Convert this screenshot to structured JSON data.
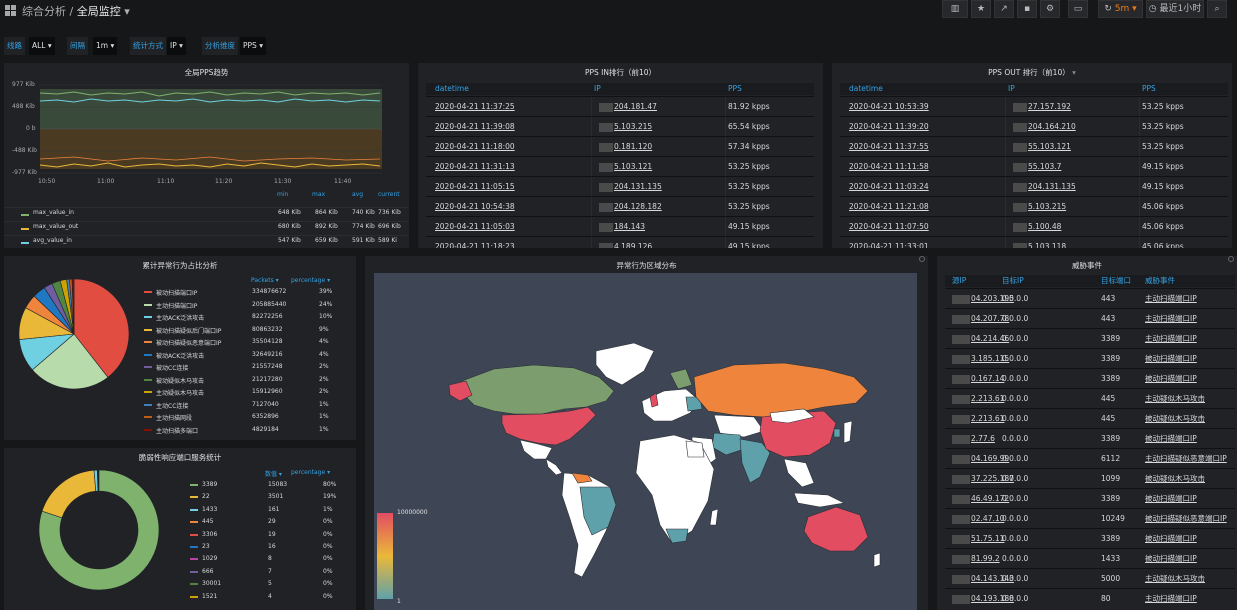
{
  "header": {
    "breadcrumb_parent": "综合分析 / ",
    "breadcrumb_current": "全局监控"
  },
  "toolbar": {
    "refresh_interval": "5m",
    "time_range": "最近1小时"
  },
  "variables": [
    {
      "label": "线路",
      "value": "ALL"
    },
    {
      "label": "间隔",
      "value": "1m"
    },
    {
      "label": "统计方式",
      "value": "IP"
    },
    {
      "label": "分析维度",
      "value": "PPS"
    }
  ],
  "pps_trend": {
    "title": "全局PPS趋势",
    "y_ticks": [
      "977 Kib",
      "488 Kib",
      "0 b",
      "-488 Kib",
      "-977 Kib"
    ],
    "x_ticks": [
      "10:50",
      "11:00",
      "11:10",
      "11:20",
      "11:30",
      "11:40"
    ],
    "legend_headers": [
      "min",
      "max",
      "avg",
      "current"
    ],
    "legend": [
      {
        "name": "max_value_in",
        "color": "#7eb26d",
        "min": "648 Kib",
        "max": "864 Kib",
        "avg": "740 Kib",
        "current": "736 Kib"
      },
      {
        "name": "max_value_out",
        "color": "#eab839",
        "min": "680 Kib",
        "max": "892 Kib",
        "avg": "774 Kib",
        "current": "696 Kib"
      },
      {
        "name": "avg_value_in",
        "color": "#6ed0e0",
        "min": "547 Kib",
        "max": "659 Kib",
        "avg": "591 Kib",
        "current": "589 Ki"
      }
    ]
  },
  "pps_in": {
    "title": "PPS IN排行（前10）",
    "headers": [
      "datetime",
      "IP",
      "PPS"
    ],
    "rows": [
      {
        "datetime": "2020-04-21 11:37:25",
        "ip": "204.181.47",
        "pps": "81.92 kpps"
      },
      {
        "datetime": "2020-04-21 11:39:08",
        "ip": "5.103.215",
        "pps": "65.54 kpps"
      },
      {
        "datetime": "2020-04-21 11:18:00",
        "ip": "0.181.120",
        "pps": "57.34 kpps"
      },
      {
        "datetime": "2020-04-21 11:31:13",
        "ip": "5.103.121",
        "pps": "53.25 kpps"
      },
      {
        "datetime": "2020-04-21 11:05:15",
        "ip": "204.131.135",
        "pps": "53.25 kpps"
      },
      {
        "datetime": "2020-04-21 10:54:38",
        "ip": "204.128.182",
        "pps": "53.25 kpps"
      },
      {
        "datetime": "2020-04-21 11:05:03",
        "ip": "184.143",
        "pps": "49.15 kpps"
      },
      {
        "datetime": "2020-04-21 11:18:23",
        "ip": "4.189.126",
        "pps": "49.15 kpps"
      }
    ]
  },
  "pps_out": {
    "title": "PPS OUT 排行（前10）",
    "headers": [
      "datetime",
      "IP",
      "PPS"
    ],
    "rows": [
      {
        "datetime": "2020-04-21 10:53:39",
        "ip": "27.157.192",
        "pps": "53.25 kpps"
      },
      {
        "datetime": "2020-04-21 11:39:20",
        "ip": "204.164.210",
        "pps": "53.25 kpps"
      },
      {
        "datetime": "2020-04-21 11:37:55",
        "ip": "55.103.121",
        "pps": "53.25 kpps"
      },
      {
        "datetime": "2020-04-21 11:11:58",
        "ip": "55.103.7",
        "pps": "49.15 kpps"
      },
      {
        "datetime": "2020-04-21 11:03:24",
        "ip": "204.131.135",
        "pps": "49.15 kpps"
      },
      {
        "datetime": "2020-04-21 11:21:08",
        "ip": "5.103.215",
        "pps": "45.06 kpps"
      },
      {
        "datetime": "2020-04-21 11:07:50",
        "ip": "5.100.48",
        "pps": "45.06 kpps"
      },
      {
        "datetime": "2020-04-21 11:33:01",
        "ip": "5.103.118",
        "pps": "45.06 kpps"
      }
    ]
  },
  "anomaly_pie": {
    "title": "累计异常行为占比分析",
    "headers": [
      "Packets",
      "percentage"
    ],
    "items": [
      {
        "name": "被动扫描端口IP",
        "packets": "334876672",
        "pct": "39%",
        "color": "#e24d42"
      },
      {
        "name": "主动扫描端口IP",
        "packets": "205885440",
        "pct": "24%",
        "color": "#b7dbab"
      },
      {
        "name": "主动ACK泛洪攻击",
        "packets": "82272256",
        "pct": "10%",
        "color": "#6ed0e0"
      },
      {
        "name": "被动扫描疑似后门端口IP",
        "packets": "80863232",
        "pct": "9%",
        "color": "#eab839"
      },
      {
        "name": "被动扫描疑似恶意端口IP",
        "packets": "35504128",
        "pct": "4%",
        "color": "#ef843c"
      },
      {
        "name": "被动ACK泛洪攻击",
        "packets": "32649216",
        "pct": "4%",
        "color": "#1f78c1"
      },
      {
        "name": "被动CC连接",
        "packets": "21557248",
        "pct": "2%",
        "color": "#705da0"
      },
      {
        "name": "被动疑似木马攻击",
        "packets": "21217280",
        "pct": "2%",
        "color": "#508642"
      },
      {
        "name": "主动疑似木马攻击",
        "packets": "15912960",
        "pct": "2%",
        "color": "#cca300"
      },
      {
        "name": "主动CC连接",
        "packets": "7127040",
        "pct": "1%",
        "color": "#447ebc"
      },
      {
        "name": "主动扫描网段",
        "packets": "6352896",
        "pct": "1%",
        "color": "#c15c17"
      },
      {
        "name": "主动扫描多端口",
        "packets": "4829184",
        "pct": "1%",
        "color": "#890f02"
      }
    ]
  },
  "port_donut": {
    "title": "脆弱性响应端口服务统计",
    "headers": [
      "数值",
      "percentage"
    ],
    "items": [
      {
        "name": "3389",
        "value": "15083",
        "pct": "80%",
        "color": "#7eb26d"
      },
      {
        "name": "22",
        "value": "3501",
        "pct": "19%",
        "color": "#eab839"
      },
      {
        "name": "1433",
        "value": "161",
        "pct": "1%",
        "color": "#6ed0e0"
      },
      {
        "name": "445",
        "value": "29",
        "pct": "0%",
        "color": "#ef843c"
      },
      {
        "name": "3306",
        "value": "19",
        "pct": "0%",
        "color": "#e24d42"
      },
      {
        "name": "23",
        "value": "16",
        "pct": "0%",
        "color": "#1f78c1"
      },
      {
        "name": "1029",
        "value": "8",
        "pct": "0%",
        "color": "#ba43a9"
      },
      {
        "name": "666",
        "value": "7",
        "pct": "0%",
        "color": "#705da0"
      },
      {
        "name": "30001",
        "value": "5",
        "pct": "0%",
        "color": "#508642"
      },
      {
        "name": "1521",
        "value": "4",
        "pct": "0%",
        "color": "#cca300"
      }
    ]
  },
  "map": {
    "title": "异常行为区域分布",
    "scale_max": "10000000",
    "scale_min": "1"
  },
  "threats": {
    "title": "威胁事件",
    "headers": [
      "源IP",
      "目标IP",
      "目标端口",
      "威胁事件"
    ],
    "rows": [
      {
        "src": "04.203.195",
        "dst": "0.0.0.0",
        "port": "443",
        "event": "主动扫描端口IP"
      },
      {
        "src": "04.207.78",
        "dst": "0.0.0.0",
        "port": "443",
        "event": "主动扫描端口IP"
      },
      {
        "src": "04.214.46",
        "dst": "0.0.0.0",
        "port": "3389",
        "event": "主动扫描端口IP"
      },
      {
        "src": "3.185.115",
        "dst": "0.0.0.0",
        "port": "3389",
        "event": "被动扫描端口IP"
      },
      {
        "src": "0.167.14",
        "dst": "0.0.0.0",
        "port": "3389",
        "event": "被动扫描端口IP"
      },
      {
        "src": "2.213.61",
        "dst": "0.0.0.0",
        "port": "445",
        "event": "主动疑似木马攻击"
      },
      {
        "src": "2.213.61",
        "dst": "0.0.0.0",
        "port": "445",
        "event": "被动疑似木马攻击"
      },
      {
        "src": "2.77.6",
        "dst": "0.0.0.0",
        "port": "3389",
        "event": "被动扫描端口IP"
      },
      {
        "src": "04.169.99",
        "dst": "0.0.0.0",
        "port": "6112",
        "event": "主动扫描疑似恶意端口IP"
      },
      {
        "src": "37.225.187",
        "dst": "0.0.0.0",
        "port": "1099",
        "event": "被动疑似木马攻击"
      },
      {
        "src": "46.49.172",
        "dst": "0.0.0.0",
        "port": "3389",
        "event": "被动扫描端口IP"
      },
      {
        "src": "02.47.10",
        "dst": "0.0.0.0",
        "port": "10249",
        "event": "被动扫描疑似恶意端口IP"
      },
      {
        "src": "51.75.11",
        "dst": "0.0.0.0",
        "port": "3389",
        "event": "被动扫描端口IP"
      },
      {
        "src": "81.99.2",
        "dst": "0.0.0.0",
        "port": "1433",
        "event": "被动扫描端口IP"
      },
      {
        "src": "04.143.143",
        "dst": "0.0.0.0",
        "port": "5000",
        "event": "主动疑似木马攻击"
      },
      {
        "src": "04.193.188",
        "dst": "0.0.0.0",
        "port": "80",
        "event": "主动扫描端口IP"
      }
    ]
  }
}
